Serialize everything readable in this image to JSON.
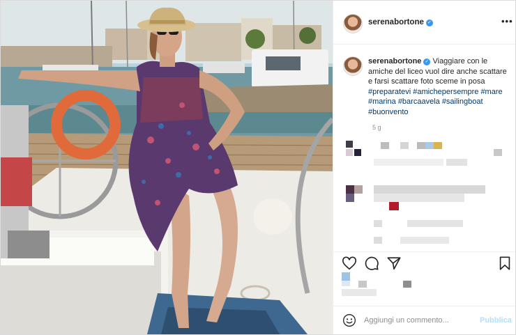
{
  "post": {
    "username": "serenabortone",
    "verified_mark": "✓",
    "more_label": "•••",
    "caption": {
      "username": "serenabortone",
      "text": "Viaggiare con le amiche del liceo vuol dire anche scattare e farsi scattare foto sceme in posa",
      "hashtags": [
        "#preparatevi",
        "#amichepersempre",
        "#mare",
        "#marina",
        "#barcaavela",
        "#sailingboat",
        "#buonvento"
      ]
    },
    "time_ago": "5 g"
  },
  "add_comment": {
    "placeholder": "Aggiungi un commento...",
    "publish_label": "Pubblica"
  },
  "icons": {
    "heart": "heart-icon",
    "comment": "comment-icon",
    "share": "share-icon",
    "bookmark": "bookmark-icon",
    "emoji": "emoji-icon",
    "more": "more-options-icon"
  },
  "colors": {
    "link": "#00376b",
    "verified": "#3897f0",
    "muted": "#8e8e8e",
    "publish_disabled": "#b2dffc"
  }
}
